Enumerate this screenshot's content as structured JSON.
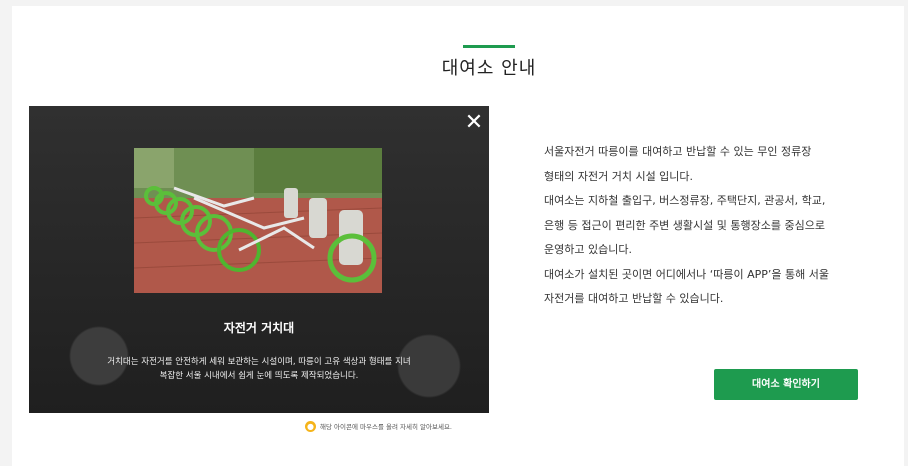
{
  "section": {
    "title": "대여소 안내"
  },
  "modal": {
    "close_glyph": "✕",
    "caption_title": "자전거 거치대",
    "caption_line1": "거치대는 자전거를 안전하게 세워 보관하는 시설이며, 따릉이 고유 색상과 형태를 지녀",
    "caption_line2": "복잡한 서울 시내에서 쉽게 눈에 띄도록 제작되었습니다."
  },
  "hint": {
    "text": "해당 아이콘에 마우스를 올려 자세히 알아보세요.",
    "icon": "hint-dot-icon",
    "icon_color": "#f5b41a"
  },
  "description": {
    "lines": [
      "서울자전거 따릉이를 대여하고 반납할 수 있는 무인 정류장",
      "형태의 자전거 거치 시설 입니다.",
      "대여소는 지하철 출입구, 버스정류장, 주택단지, 관공서, 학교,",
      "은행 등 접근이 편리한 주변 생활시설 및 통행장소를 중심으로",
      "운영하고 있습니다.",
      "대여소가 설치된 곳이면 어디에서나 ‘따릉이 APP’을 통해 서울",
      "자전거를 대여하고 반납할 수 있습니다."
    ]
  },
  "cta": {
    "label": "대여소 확인하기"
  },
  "colors": {
    "accent": "#1e9b4f",
    "modal_bg": "#2a2a2a"
  }
}
